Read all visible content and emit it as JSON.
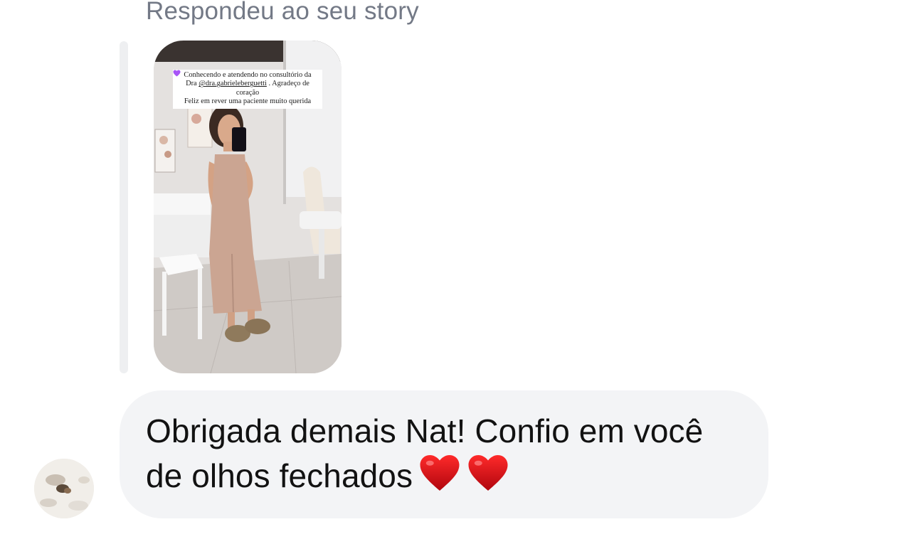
{
  "thread": {
    "reply_label": "Respondeu ao seu story"
  },
  "story": {
    "caption_line1": "Conhecendo e atendendo no consultório da",
    "caption_prefix": "Dra",
    "caption_mention": "@dra.gabrieleberguetti",
    "caption_suffix": ". Agradeço de",
    "caption_line3": "coração",
    "caption_line4": "Feliz em rever uma paciente muito querida",
    "caption_emoji": "purple-heart-icon"
  },
  "message": {
    "text": "Obrigada demais Nat! Confio em você de olhos fechados",
    "emojis": [
      "red-heart-icon",
      "red-heart-icon"
    ]
  },
  "colors": {
    "bubble_bg": "#f3f4f6",
    "label_text": "#737986",
    "heart_red": "#d0141c",
    "caption_heart": "#a855f7"
  }
}
